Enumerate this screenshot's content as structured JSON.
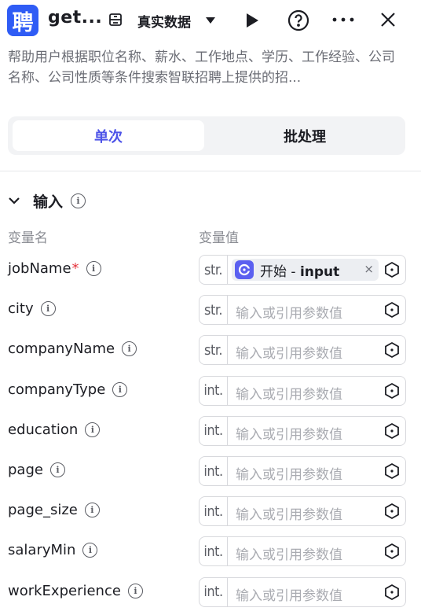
{
  "header": {
    "logo_char": "聘",
    "title": "get...",
    "mode_label": "真实数据"
  },
  "description": "帮助用户根据职位名称、薪水、工作地点、学历、工作经验、公司名称、公司性质等条件搜索智联招聘上提供的招...",
  "tabs": {
    "single": "单次",
    "batch": "批处理"
  },
  "section": {
    "title": "输入"
  },
  "columns": {
    "name": "变量名",
    "value": "变量值"
  },
  "placeholder": "输入或引用参数值",
  "params": [
    {
      "name": "jobName",
      "required": "*",
      "type": "str.",
      "ref_source": "开始",
      "ref_sep": " - ",
      "ref_var": "input"
    },
    {
      "name": "city",
      "type": "str."
    },
    {
      "name": "companyName",
      "type": "str."
    },
    {
      "name": "companyType",
      "type": "int."
    },
    {
      "name": "education",
      "type": "int."
    },
    {
      "name": "page",
      "type": "int."
    },
    {
      "name": "page_size",
      "type": "int."
    },
    {
      "name": "salaryMin",
      "type": "int."
    },
    {
      "name": "workExperience",
      "type": "int."
    }
  ],
  "icons": {
    "close_ref": "×",
    "info": "i"
  },
  "colors": {
    "accent": "#4d53e8",
    "logo": "#2f5cf5",
    "required": "#e5343d"
  }
}
